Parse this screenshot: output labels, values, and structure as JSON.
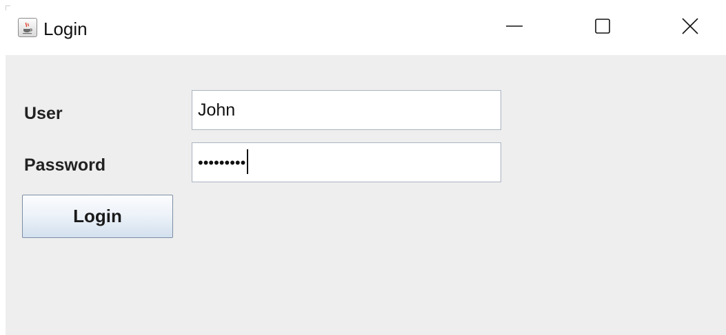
{
  "window": {
    "title": "Login",
    "app_icon": "java-cup-icon",
    "controls": {
      "minimize_icon": "minimize-icon",
      "maximize_icon": "maximize-icon",
      "close_icon": "close-icon"
    }
  },
  "form": {
    "user_label": "User",
    "user_value": "John",
    "password_label": "Password",
    "password_mask": "•••••••••",
    "login_button_label": "Login"
  },
  "colors": {
    "content_background": "#eeeeee",
    "field_border": "#a9b3bf",
    "button_border": "#7a8ca3"
  }
}
